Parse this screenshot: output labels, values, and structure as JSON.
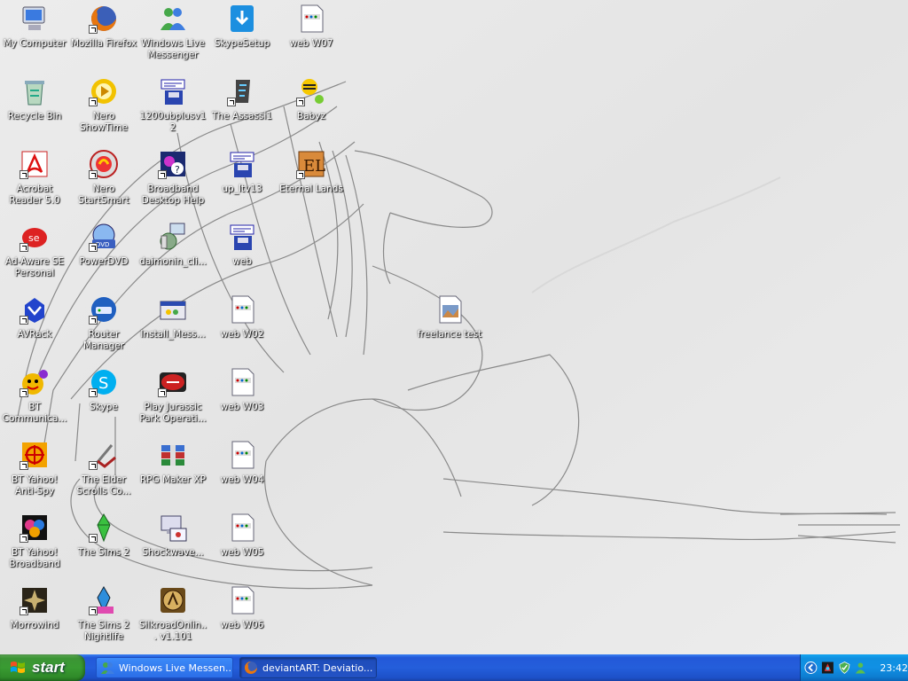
{
  "desktop": {
    "icons": [
      {
        "label": "My Computer",
        "icon": "my-computer-icon",
        "shortcut": false
      },
      {
        "label": "Mozilla Firefox",
        "icon": "firefox-icon",
        "shortcut": true
      },
      {
        "label": "Windows Live Messenger",
        "icon": "messenger-icon",
        "shortcut": false
      },
      {
        "label": "SkypeSetup",
        "icon": "skype-setup-icon",
        "shortcut": false
      },
      {
        "label": "web W07",
        "icon": "html-file-icon",
        "shortcut": false
      },
      {
        "label": "Recycle Bin",
        "icon": "recycle-bin-icon",
        "shortcut": false
      },
      {
        "label": "Nero ShowTime",
        "icon": "nero-showtime-icon",
        "shortcut": true
      },
      {
        "label": "1200ubplusv12",
        "icon": "installer-icon",
        "shortcut": false
      },
      {
        "label": "The Assassi1",
        "icon": "assassin-icon",
        "shortcut": true
      },
      {
        "label": "Babyz",
        "icon": "babyz-icon",
        "shortcut": true
      },
      {
        "label": "Acrobat Reader 5.0",
        "icon": "acrobat-icon",
        "shortcut": true
      },
      {
        "label": "Nero StartSmart",
        "icon": "nero-startsmart-icon",
        "shortcut": true
      },
      {
        "label": "Broadband Desktop Help",
        "icon": "help-icon",
        "shortcut": true
      },
      {
        "label": "up_ltv13",
        "icon": "installer-icon",
        "shortcut": false
      },
      {
        "label": "Eternal Lands",
        "icon": "eternal-lands-icon",
        "shortcut": true
      },
      {
        "label": "Ad-Aware SE Personal",
        "icon": "adaware-icon",
        "shortcut": true
      },
      {
        "label": "PowerDVD",
        "icon": "powerdvd-icon",
        "shortcut": true
      },
      {
        "label": "daimonin_cli...",
        "icon": "network-installer-icon",
        "shortcut": false
      },
      {
        "label": "web",
        "icon": "installer-icon",
        "shortcut": false
      },
      {
        "label": "AVRack",
        "icon": "avrack-icon",
        "shortcut": true
      },
      {
        "label": "Router Manager",
        "icon": "router-manager-icon",
        "shortcut": true
      },
      {
        "label": "Install_Mess...",
        "icon": "install-messenger-icon",
        "shortcut": false
      },
      {
        "label": "web W02",
        "icon": "html-file-icon",
        "shortcut": false
      },
      {
        "label": "freelance test",
        "icon": "image-file-icon",
        "shortcut": false
      },
      {
        "label": "BT Communica...",
        "icon": "bt-communicator-icon",
        "shortcut": true
      },
      {
        "label": "Skype",
        "icon": "skype-icon",
        "shortcut": true
      },
      {
        "label": "Play Jurassic Park Operati...",
        "icon": "jurassic-park-icon",
        "shortcut": true
      },
      {
        "label": "web W03",
        "icon": "html-file-icon",
        "shortcut": false
      },
      {
        "label": "BT Yahoo! Anti-Spy",
        "icon": "anti-spy-icon",
        "shortcut": true
      },
      {
        "label": "The Elder Scrolls Co...",
        "icon": "elder-scrolls-icon",
        "shortcut": true
      },
      {
        "label": "RPG Maker XP",
        "icon": "rpg-maker-icon",
        "shortcut": false
      },
      {
        "label": "web W04",
        "icon": "html-file-icon",
        "shortcut": false
      },
      {
        "label": "BT Yahoo! Broadband",
        "icon": "bt-broadband-icon",
        "shortcut": true
      },
      {
        "label": "The Sims 2",
        "icon": "sims2-icon",
        "shortcut": true
      },
      {
        "label": "Shockwave...",
        "icon": "shockwave-icon",
        "shortcut": false
      },
      {
        "label": "web W05",
        "icon": "html-file-icon",
        "shortcut": false
      },
      {
        "label": "Morrowind",
        "icon": "morrowind-icon",
        "shortcut": true
      },
      {
        "label": "The Sims 2 Nightlife",
        "icon": "sims2-nightlife-icon",
        "shortcut": true
      },
      {
        "label": "SilkroadOnlin... v1.101",
        "icon": "silkroad-icon",
        "shortcut": false
      },
      {
        "label": "web W06",
        "icon": "html-file-icon",
        "shortcut": false
      }
    ]
  },
  "taskbar": {
    "start_label": "start",
    "tasks": [
      {
        "label": "Windows Live Messen...",
        "icon": "messenger-icon",
        "active": false
      },
      {
        "label": "deviantART: Deviatio...",
        "icon": "firefox-icon",
        "active": true
      }
    ],
    "tray_icons": [
      "show-hidden-icons-chevron-icon",
      "cyberlink-icon",
      "security-shield-icon",
      "messenger-status-icon"
    ],
    "clock": "23:42"
  },
  "colors": {
    "taskbar_blue": "#245edb",
    "start_green": "#399b32",
    "tray_blue": "#1190e4"
  }
}
